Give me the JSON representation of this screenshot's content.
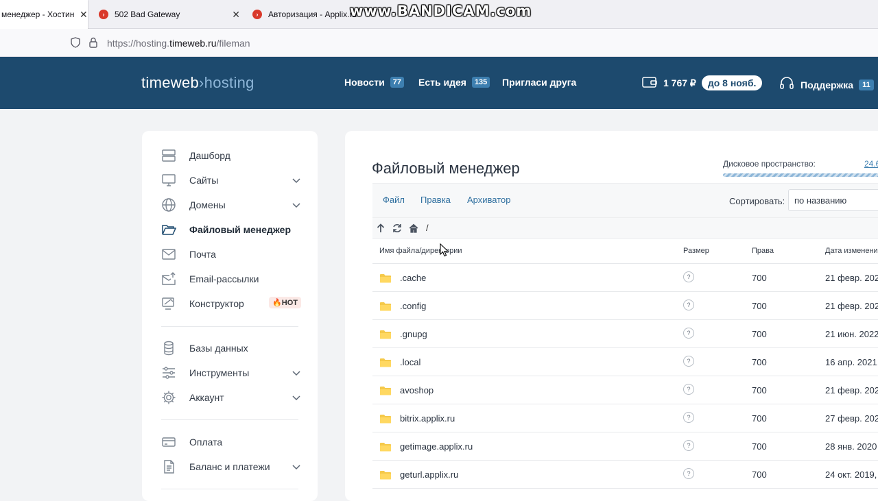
{
  "browser": {
    "tabs": [
      {
        "title": "менеджер - Хостин",
        "close": "✕"
      },
      {
        "title": "502 Bad Gateway",
        "close": "✕"
      },
      {
        "title": "Авторизация - Applix.ru",
        "close": ""
      }
    ],
    "url_prefix": "https://hosting.",
    "url_domain": "timeweb.ru",
    "url_path": "/fileman",
    "watermark": "www.BANDICAM.com"
  },
  "header": {
    "logo_main": "timeweb",
    "logo_sep": "›",
    "logo_sub": "hosting",
    "nav": [
      {
        "label": "Новости",
        "count": "77"
      },
      {
        "label": "Есть идея",
        "count": "135"
      },
      {
        "label": "Пригласи друга",
        "count": ""
      }
    ],
    "balance": "1 767 ₽",
    "paid_until": "до 8 нояб.",
    "support_label": "Поддержка",
    "support_count": "11"
  },
  "sidebar": {
    "items": [
      {
        "label": "Дашборд"
      },
      {
        "label": "Сайты"
      },
      {
        "label": "Домены"
      },
      {
        "label": "Файловый менеджер"
      },
      {
        "label": "Почта"
      },
      {
        "label": "Email-рассылки"
      },
      {
        "label": "Конструктор",
        "badge": "🔥HOT"
      },
      {
        "label": "Базы данных"
      },
      {
        "label": "Инструменты"
      },
      {
        "label": "Аккаунт"
      },
      {
        "label": "Оплата"
      },
      {
        "label": "Баланс и платежи"
      }
    ]
  },
  "main": {
    "title": "Файловый менеджер",
    "disk_label": "Дисковое пространство:",
    "disk_value": "24.6",
    "menu": [
      "Файл",
      "Правка",
      "Архиватор"
    ],
    "sort_label": "Сортировать:",
    "sort_value": "по названию",
    "path": "/",
    "columns": [
      "Имя файла/директории",
      "Размер",
      "Права",
      "Дата изменени"
    ],
    "rows": [
      {
        "name": ".cache",
        "size": "?",
        "perm": "700",
        "date": "21 февр. 202"
      },
      {
        "name": ".config",
        "size": "?",
        "perm": "700",
        "date": "21 февр. 202"
      },
      {
        "name": ".gnupg",
        "size": "?",
        "perm": "700",
        "date": "21 июн. 2022"
      },
      {
        "name": ".local",
        "size": "?",
        "perm": "700",
        "date": "16 апр. 2021,"
      },
      {
        "name": "avoshop",
        "size": "?",
        "perm": "700",
        "date": "21 февр. 202"
      },
      {
        "name": "bitrix.applix.ru",
        "size": "?",
        "perm": "700",
        "date": "27 февр. 202"
      },
      {
        "name": "getimage.applix.ru",
        "size": "?",
        "perm": "700",
        "date": "28 янв. 2020"
      },
      {
        "name": "geturl.applix.ru",
        "size": "?",
        "perm": "700",
        "date": "24 окт. 2019,"
      }
    ]
  }
}
